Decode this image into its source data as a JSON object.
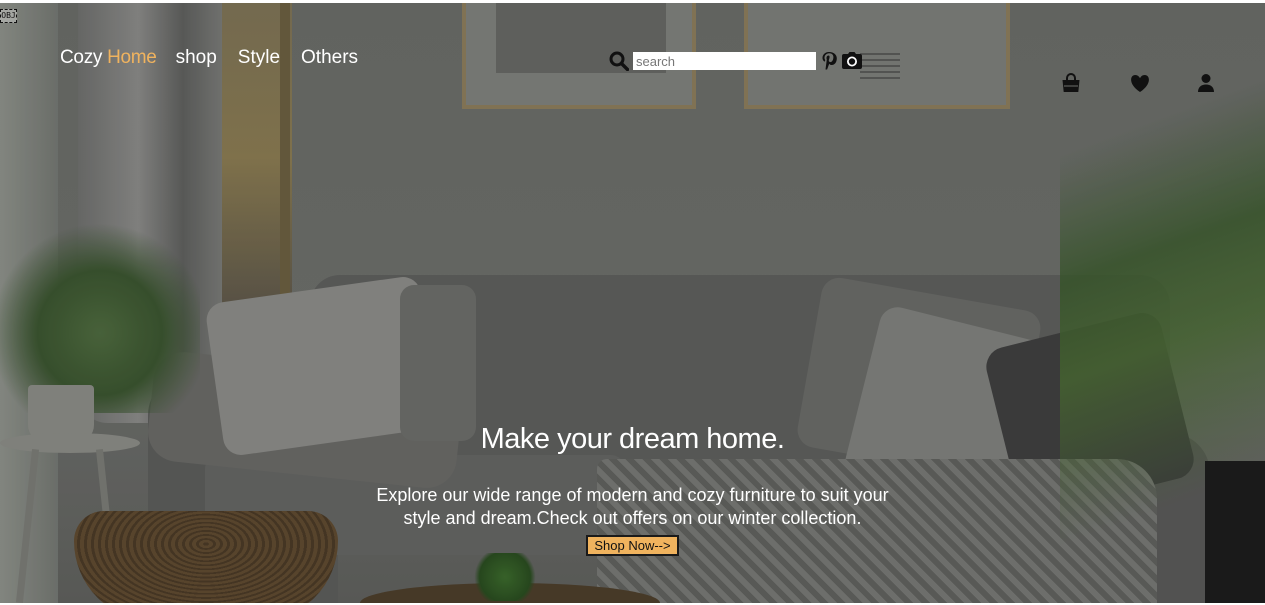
{
  "nav": {
    "brand_part1": "Cozy",
    "brand_part2": "Home",
    "links": [
      "shop",
      "Style",
      "Others"
    ]
  },
  "search": {
    "placeholder": "search"
  },
  "social_icons": [
    "pinterest-icon",
    "camera-icon"
  ],
  "header_icons": [
    "shopping-bag-icon",
    "heart-icon",
    "user-icon"
  ],
  "broken_image_alt": "OBJ",
  "hero": {
    "title": "Make your dream home.",
    "subtitle": "Explore our wide range of modern and cozy furniture to suit your style and dream.Check out offers on our winter collection.",
    "cta_label": "Shop Now-->"
  },
  "colors": {
    "accent": "#f0b35e",
    "text": "#ffffff",
    "icon": "#111111"
  }
}
